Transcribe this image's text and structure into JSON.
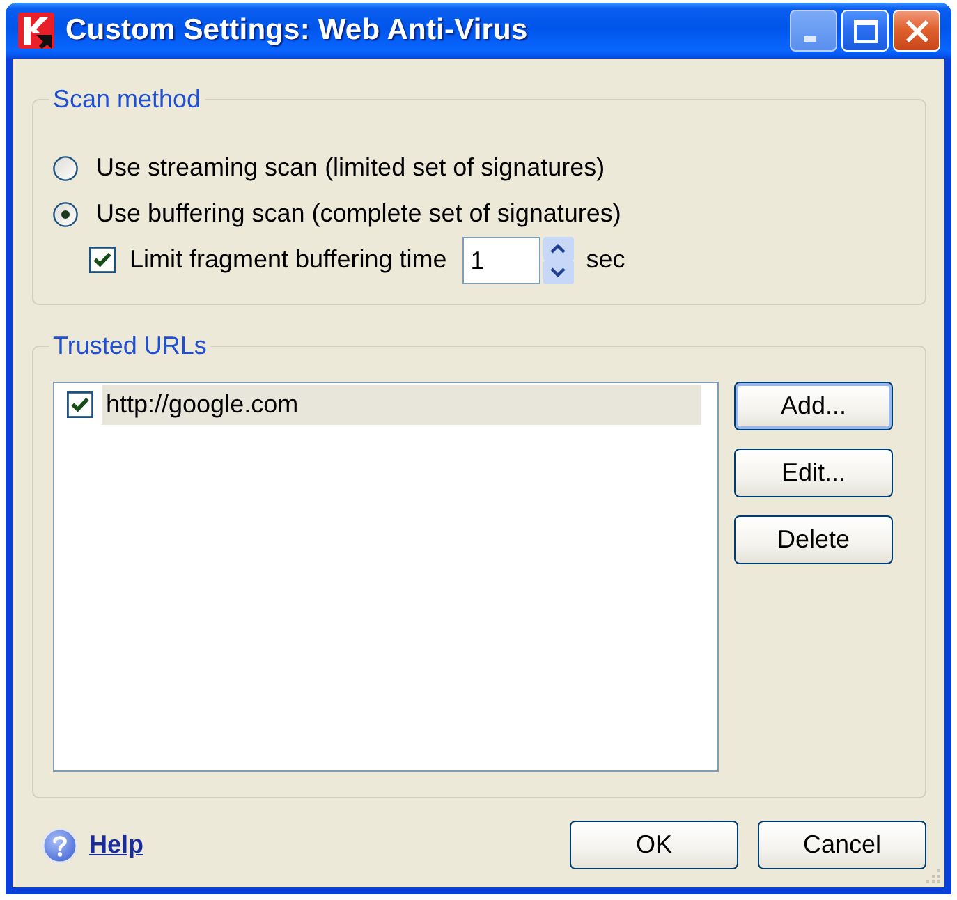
{
  "window": {
    "title": "Custom Settings: Web Anti-Virus",
    "title_buttons": [
      {
        "kind": "minimize",
        "disabled": true
      },
      {
        "kind": "maximize",
        "disabled": false
      },
      {
        "kind": "close",
        "disabled": false
      }
    ]
  },
  "scan_method": {
    "legend": "Scan method",
    "options": [
      {
        "label": "Use streaming scan (limited set of signatures)",
        "selected": false
      },
      {
        "label": "Use buffering scan (complete set of signatures)",
        "selected": true
      }
    ],
    "limit": {
      "label": "Limit fragment buffering time",
      "checked": true,
      "value": "1",
      "unit": "sec"
    }
  },
  "trusted_urls": {
    "legend": "Trusted URLs",
    "items": [
      {
        "url": "http://google.com",
        "checked": true,
        "selected": true
      }
    ],
    "buttons": [
      {
        "label": "Add...",
        "focused": true
      },
      {
        "label": "Edit...",
        "focused": false
      },
      {
        "label": "Delete",
        "focused": false
      }
    ]
  },
  "footer": {
    "help": "Help",
    "buttons": [
      {
        "label": "OK"
      },
      {
        "label": "Cancel"
      }
    ]
  }
}
